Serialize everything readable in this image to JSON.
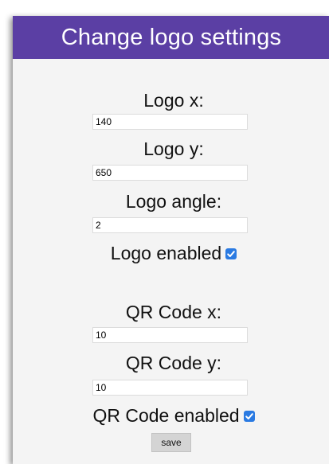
{
  "header": {
    "title": "Change logo settings"
  },
  "logo": {
    "x_label": "Logo x:",
    "x_value": "140",
    "y_label": "Logo y:",
    "y_value": "650",
    "angle_label": "Logo angle:",
    "angle_value": "2",
    "enabled_label": "Logo enabled",
    "enabled": true
  },
  "qr": {
    "x_label": "QR Code x:",
    "x_value": "10",
    "y_label": "QR Code y:",
    "y_value": "10",
    "enabled_label": "QR Code enabled",
    "enabled": true
  },
  "save_label": "save",
  "colors": {
    "header_bg": "#5b3fa4",
    "checkbox": "#2a7ae2"
  }
}
